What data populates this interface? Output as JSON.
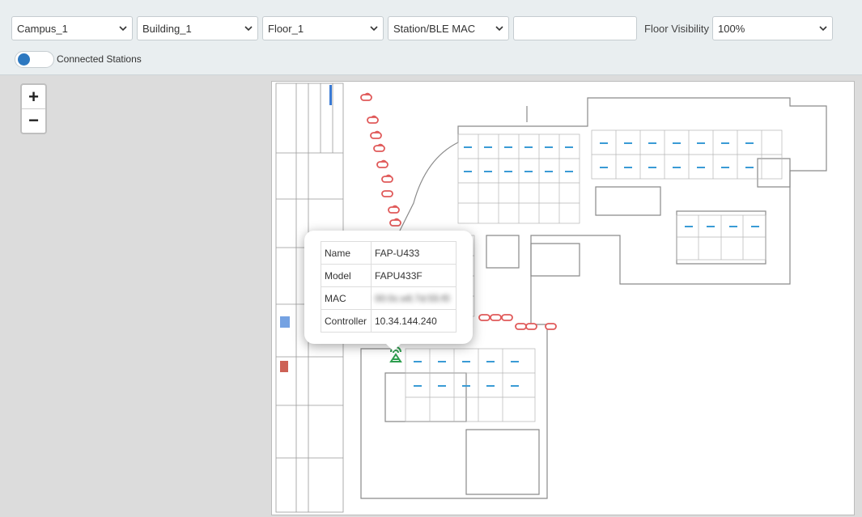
{
  "filters": {
    "campus": "Campus_1",
    "building": "Building_1",
    "floor": "Floor_1",
    "search_by": "Station/BLE MAC",
    "search_value": "",
    "floor_visibility_label": "Floor Visibility",
    "floor_visibility": "100%"
  },
  "toggle": {
    "label": "Connected Stations",
    "state": "on"
  },
  "zoom": {
    "in_label": "+",
    "out_label": "−"
  },
  "ap_popup": {
    "rows": [
      {
        "key": "Name",
        "value": "FAP-U433"
      },
      {
        "key": "Model",
        "value": "FAPU433F"
      },
      {
        "key": "MAC",
        "value": "00:0c:e6:7d:55:f0"
      },
      {
        "key": "Controller",
        "value": "10.34.144.240"
      }
    ]
  },
  "colors": {
    "accent": "#2d78c0",
    "station_icon": "#e05a5a",
    "ap_icon": "#2e9e4f"
  },
  "icons": {
    "dropdown": "chevron-down-icon",
    "station": "station-marker-icon",
    "access_point": "access-point-icon"
  }
}
